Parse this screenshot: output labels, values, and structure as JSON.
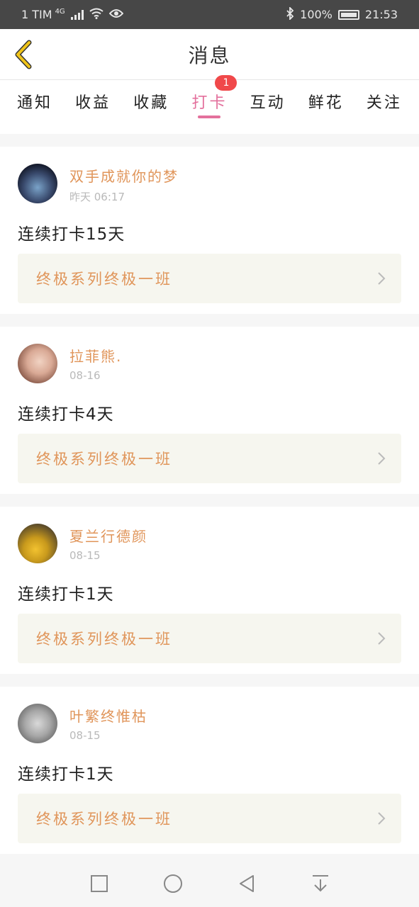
{
  "status_bar": {
    "carrier": "1 TIM",
    "network": "4G",
    "battery": "100%",
    "time": "21:53"
  },
  "header": {
    "title": "消息",
    "back_icon": "chevron-left-icon",
    "back_color": "#f0c419"
  },
  "tabs": [
    {
      "label": "通知"
    },
    {
      "label": "收益"
    },
    {
      "label": "收藏"
    },
    {
      "label": "打卡",
      "active": true,
      "badge": "1"
    },
    {
      "label": "互动"
    },
    {
      "label": "鲜花"
    },
    {
      "label": "关注"
    }
  ],
  "colors": {
    "accent_pink": "#e3709c",
    "name_orange": "#e0955a",
    "badge_red": "#f0484a"
  },
  "cards": [
    {
      "username": "双手成就你的梦",
      "time": "昨天 06:17",
      "message": "连续打卡15天",
      "class_name": "终极系列终极一班"
    },
    {
      "username": "拉菲熊.",
      "time": "08-16",
      "message": "连续打卡4天",
      "class_name": "终极系列终极一班"
    },
    {
      "username": "夏兰行德颜",
      "time": "08-15",
      "message": "连续打卡1天",
      "class_name": "终极系列终极一班"
    },
    {
      "username": "叶繁终惟枯",
      "time": "08-15",
      "message": "连续打卡1天",
      "class_name": "终极系列终极一班"
    }
  ],
  "nav": [
    "square-icon",
    "circle-home-icon",
    "triangle-back-icon",
    "down-arrow-icon"
  ]
}
